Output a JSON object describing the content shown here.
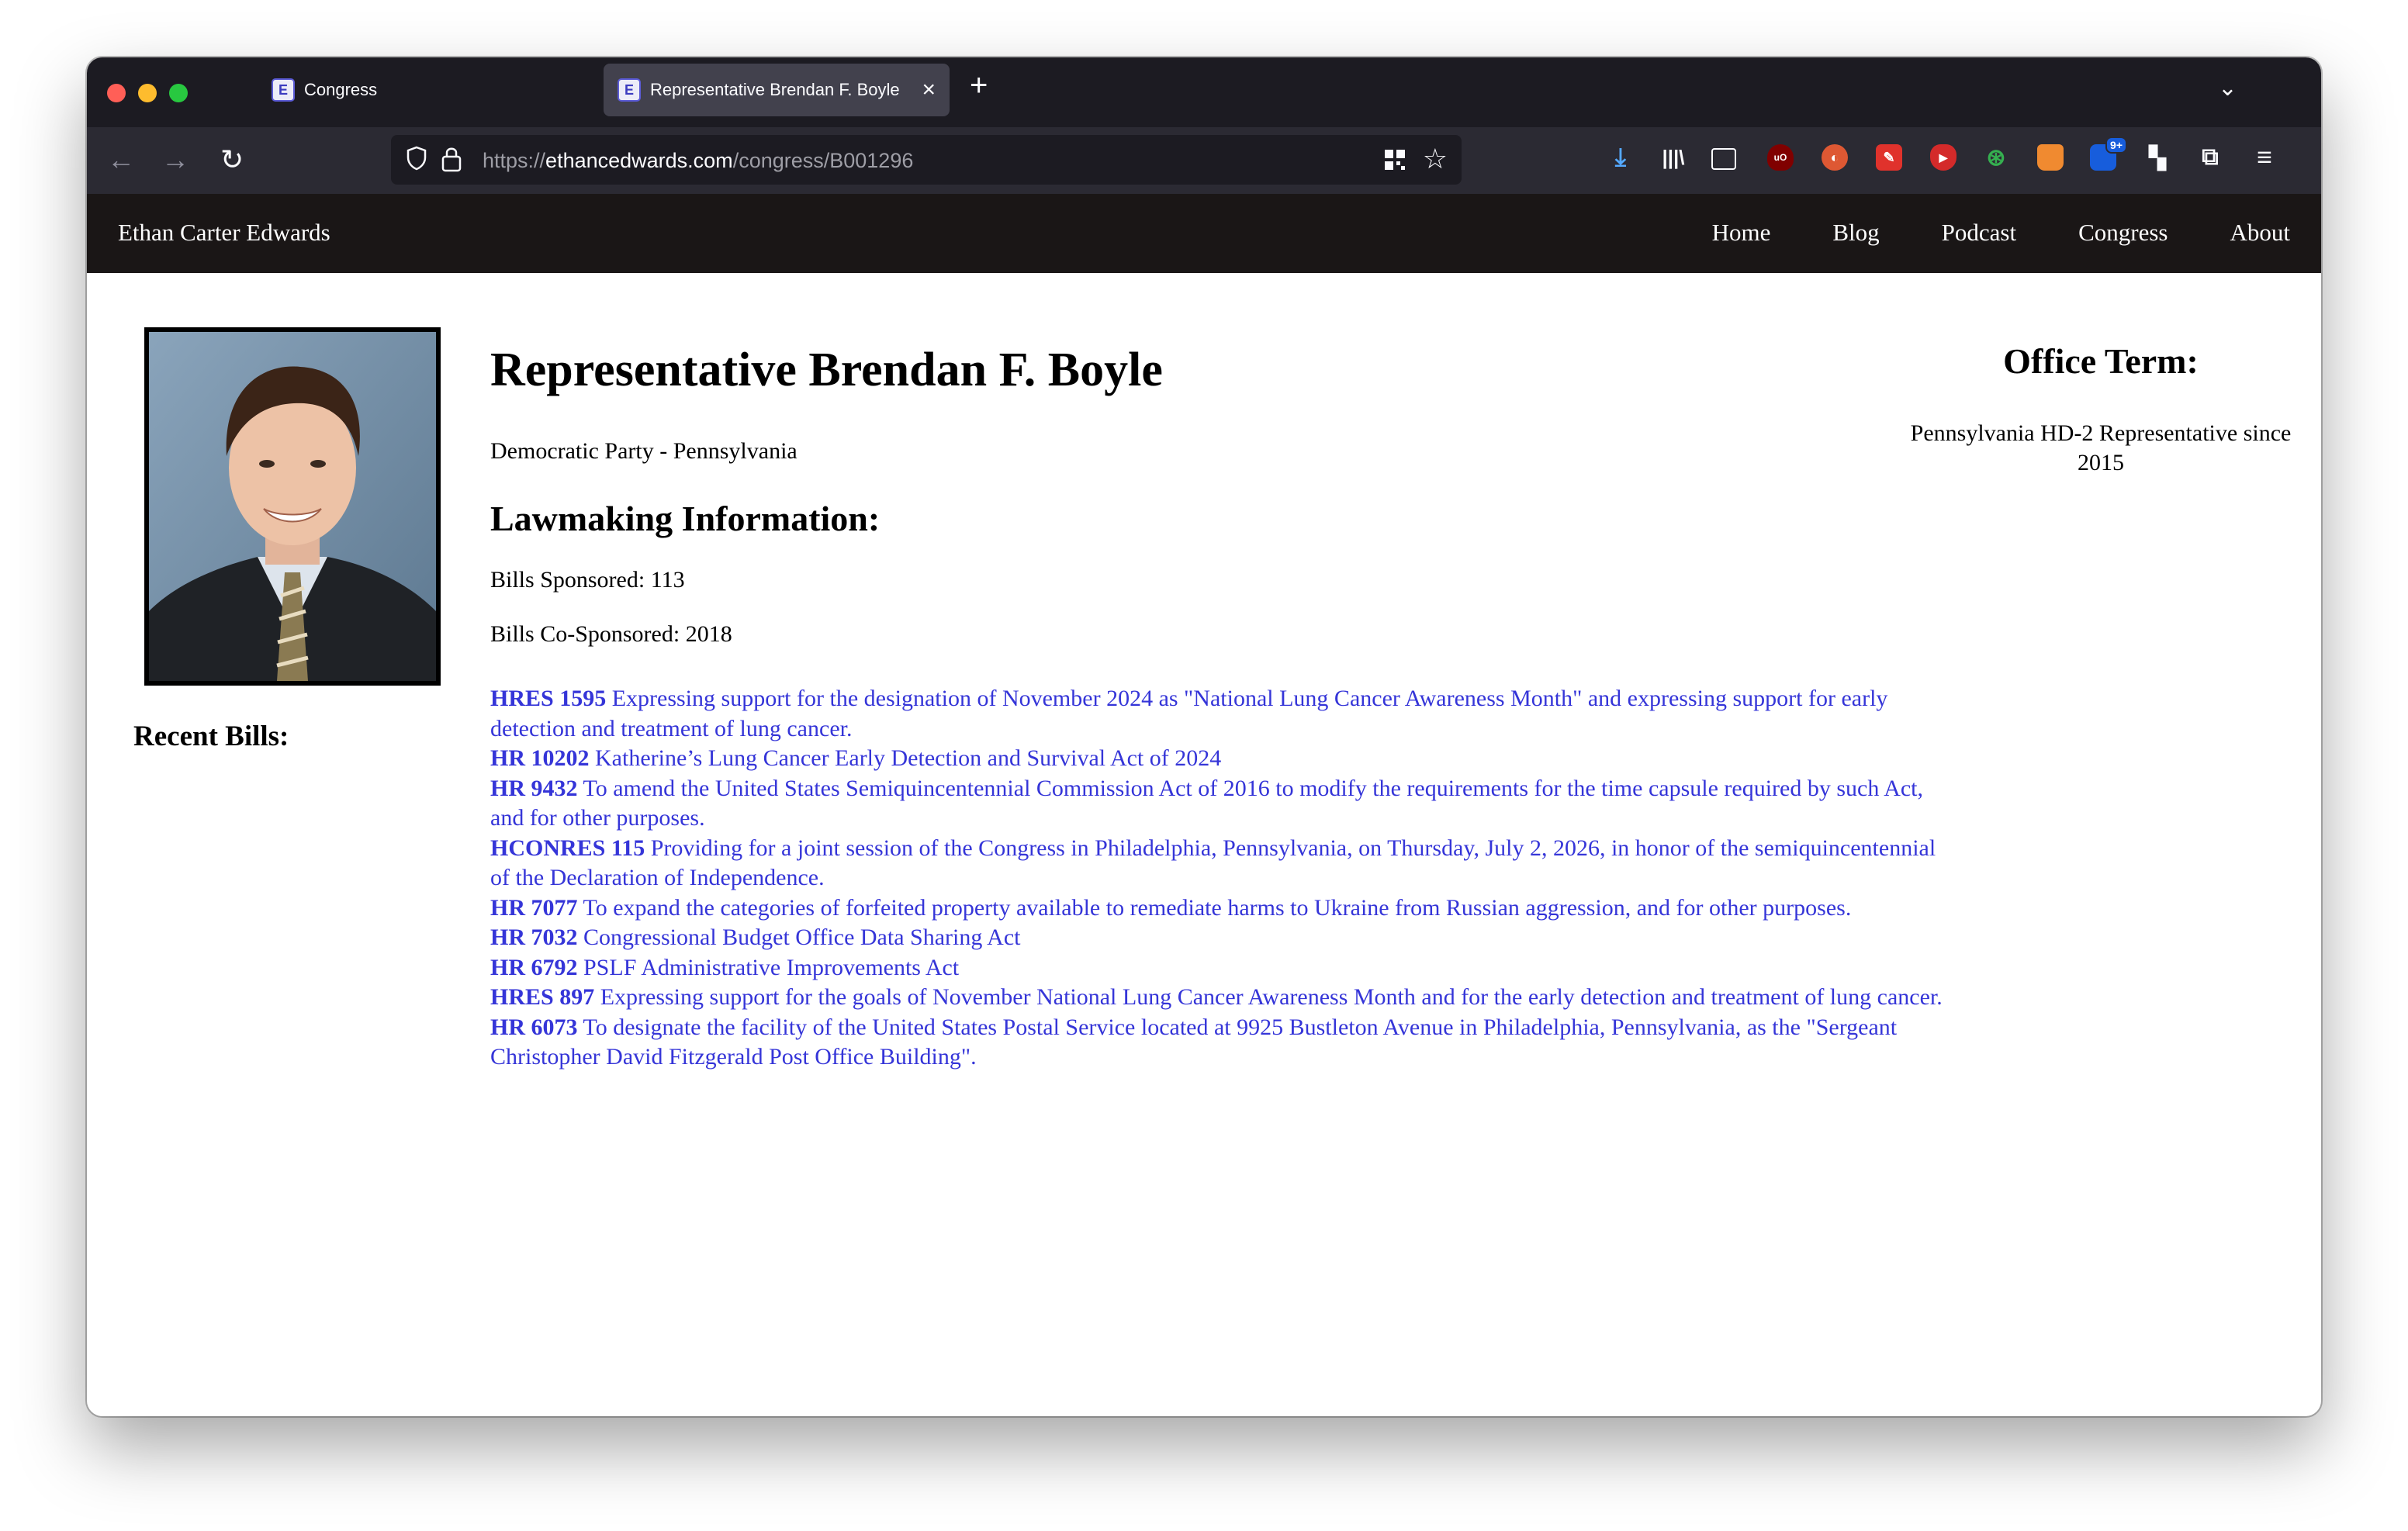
{
  "browser": {
    "tabs": [
      {
        "title": "Congress",
        "active": false
      },
      {
        "title": "Representative Brendan F. Boyle",
        "active": true
      }
    ],
    "url": {
      "scheme": "https://",
      "domain": "ethancedwards.com",
      "path": "/congress/B001296"
    },
    "extensions": [
      "download-icon",
      "library-icon",
      "sidebar-icon",
      "ublock-icon",
      "duckduckgo-icon",
      "color-picker-icon",
      "youtube-icon",
      "vpn-icon",
      "fox-icon",
      "bitwarden-icon",
      "grid-extension-icon",
      "puzzle-icon",
      "menu-icon"
    ],
    "extension_badge": "9+"
  },
  "site": {
    "brand": "Ethan Carter Edwards",
    "nav": [
      "Home",
      "Blog",
      "Podcast",
      "Congress",
      "About"
    ]
  },
  "profile": {
    "name": "Representative Brendan F. Boyle",
    "party_state": "Democratic Party - Pennsylvania",
    "lawmaking_heading": "Lawmaking Information:",
    "sponsored": "Bills Sponsored: 113",
    "cosponsored": "Bills Co-Sponsored: 2018",
    "recent_bills_heading": "Recent Bills:",
    "office_heading": "Office Term:",
    "office_term": "Pennsylvania HD-2 Representative since 2015"
  },
  "bills": [
    {
      "id": "HRES 1595",
      "title": "Expressing support for the designation of November 2024 as \"National Lung Cancer Awareness Month\" and expressing support for early detection and treatment of lung cancer."
    },
    {
      "id": "HR 10202",
      "title": "Katherine’s Lung Cancer Early Detection and Survival Act of 2024"
    },
    {
      "id": "HR 9432",
      "title": "To amend the United States Semiquincentennial Commission Act of 2016 to modify the requirements for the time capsule required by such Act, and for other purposes."
    },
    {
      "id": "HCONRES 115",
      "title": "Providing for a joint session of the Congress in Philadelphia, Pennsylvania, on Thursday, July 2, 2026, in honor of the semiquincentennial of the Declaration of Independence."
    },
    {
      "id": "HR 7077",
      "title": "To expand the categories of forfeited property available to remediate harms to Ukraine from Russian aggression, and for other purposes."
    },
    {
      "id": "HR 7032",
      "title": "Congressional Budget Office Data Sharing Act"
    },
    {
      "id": "HR 6792",
      "title": "PSLF Administrative Improvements Act"
    },
    {
      "id": "HRES 897",
      "title": "Expressing support for the goals of November National Lung Cancer Awareness Month and for the early detection and treatment of lung cancer."
    },
    {
      "id": "HR 6073",
      "title": "To designate the facility of the United States Postal Service located at 9925 Bustleton Avenue in Philadelphia, Pennsylvania, as the \"Sergeant Christopher David Fitzgerald Post Office Building\"."
    }
  ]
}
